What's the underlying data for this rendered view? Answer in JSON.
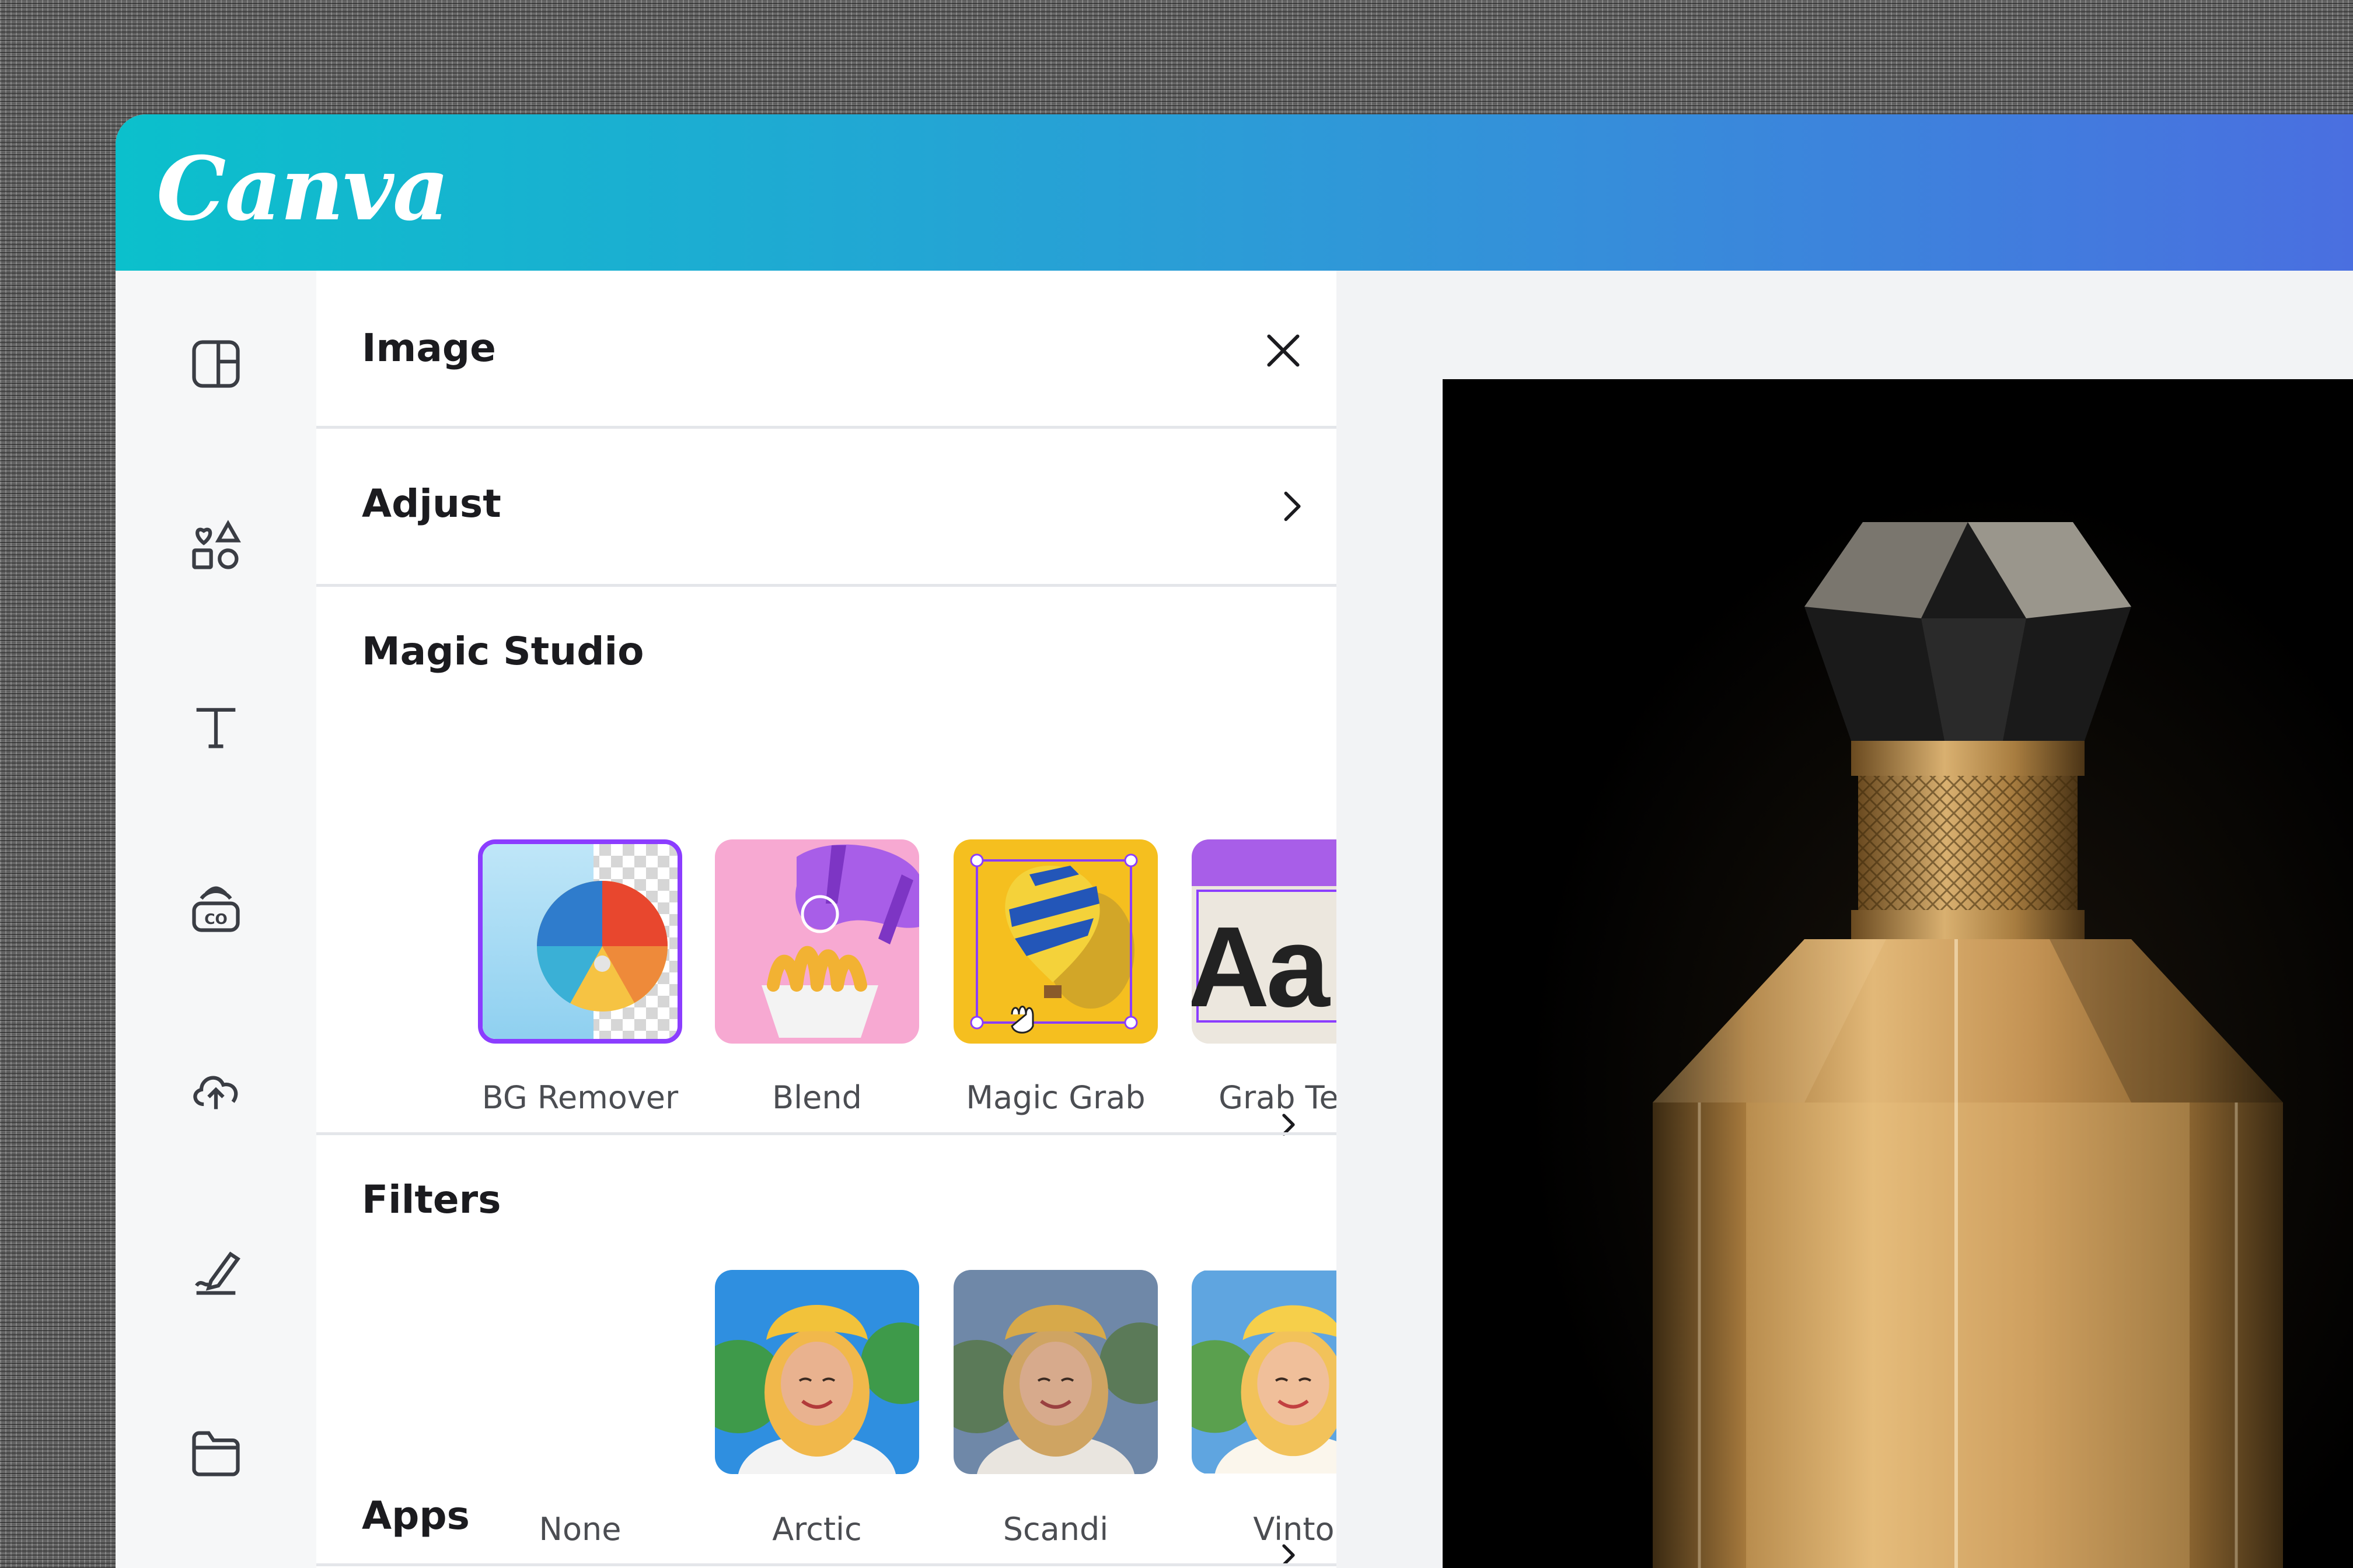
{
  "app": {
    "logo": "Canva"
  },
  "panel": {
    "title": "Image",
    "adjust_label": "Adjust",
    "magic_studio": {
      "heading": "Magic Studio",
      "tools": [
        {
          "label": "BG Remover"
        },
        {
          "label": "Blend"
        },
        {
          "label": "Magic Grab"
        },
        {
          "label": "Grab Text"
        }
      ]
    },
    "filters": {
      "heading": "Filters",
      "items": [
        {
          "label": "None"
        },
        {
          "label": "Arctic"
        },
        {
          "label": "Scandi"
        },
        {
          "label": "Vinto"
        }
      ]
    },
    "apps_heading": "Apps"
  },
  "magic_grab_tile": {
    "text": "Aa"
  },
  "colors": {
    "header_start": "#0bc0cc",
    "header_end": "#4a6fe0",
    "selection_purple": "#8b3dff"
  },
  "icons": {
    "rail": [
      "layout-icon",
      "elements-icon",
      "text-icon",
      "brand-icon",
      "upload-icon",
      "draw-icon",
      "folder-icon"
    ],
    "close": "close-icon",
    "chevron": "chevron-right-icon"
  }
}
